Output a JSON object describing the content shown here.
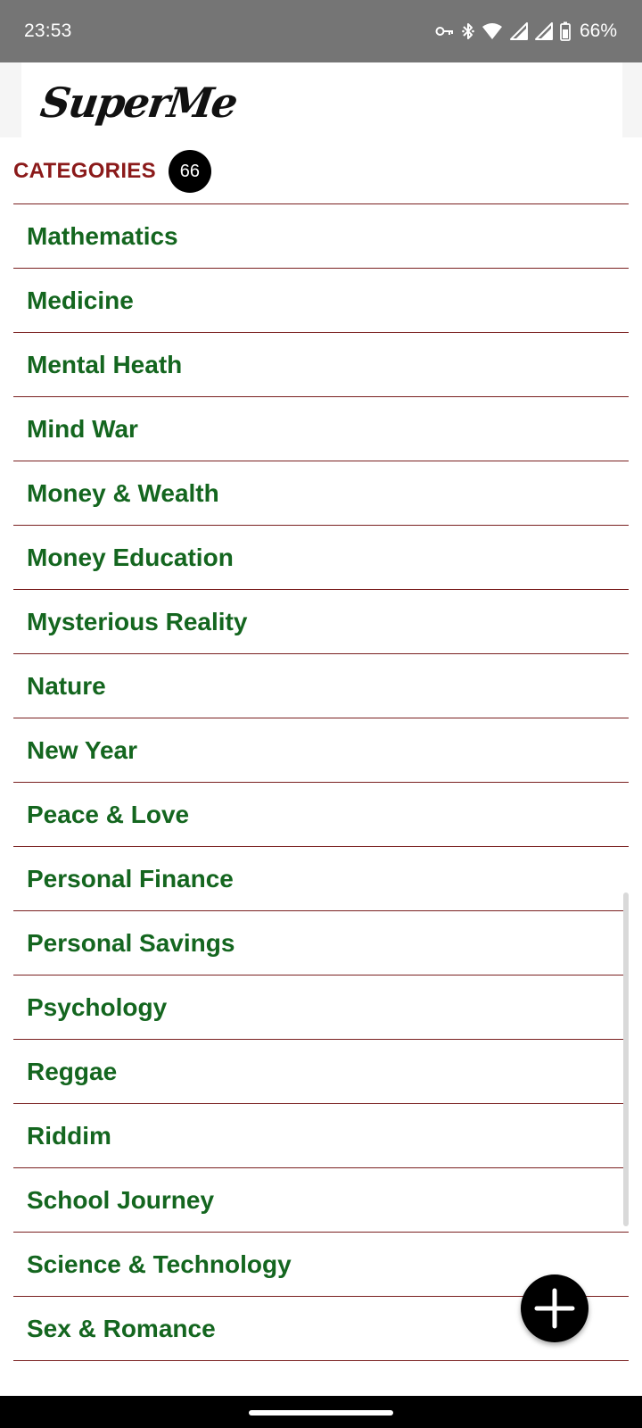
{
  "status_bar": {
    "time": "23:53",
    "battery_percent": "66%",
    "icons": [
      "vpn-key-icon",
      "bluetooth-icon",
      "wifi-icon",
      "signal-icon",
      "signal-icon",
      "battery-icon"
    ]
  },
  "header": {
    "logo_text": "SuperMe"
  },
  "categories": {
    "title": "CATEGORIES",
    "count": "66",
    "items": [
      {
        "label": "Mathematics"
      },
      {
        "label": "Medicine"
      },
      {
        "label": "Mental Heath"
      },
      {
        "label": "Mind War"
      },
      {
        "label": "Money & Wealth"
      },
      {
        "label": "Money Education"
      },
      {
        "label": "Mysterious Reality"
      },
      {
        "label": "Nature"
      },
      {
        "label": "New Year"
      },
      {
        "label": "Peace & Love"
      },
      {
        "label": "Personal Finance"
      },
      {
        "label": "Personal Savings"
      },
      {
        "label": "Psychology"
      },
      {
        "label": "Reggae"
      },
      {
        "label": "Riddim"
      },
      {
        "label": "School Journey"
      },
      {
        "label": "Science & Technology"
      },
      {
        "label": "Sex & Romance"
      }
    ]
  },
  "fab": {
    "icon": "plus-icon"
  },
  "colors": {
    "status_bar": "#757575",
    "heading": "#8b1a1a",
    "item_text": "#14661f",
    "divider": "#7a2020",
    "badge": "#000000",
    "fab": "#000000"
  }
}
